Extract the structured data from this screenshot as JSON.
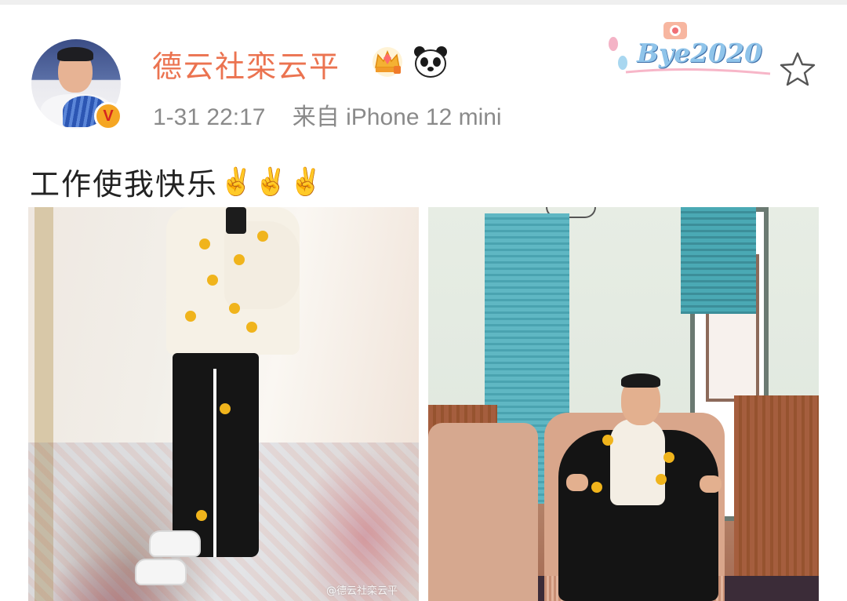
{
  "post": {
    "username": "德云社栾云平",
    "time": "1-31 22:17",
    "source": "来自 iPhone 12 mini",
    "text": "工作使我快乐",
    "emoji": "✌️✌️✌️",
    "card_text": "Bye2020",
    "watermark": "@德云社栾云平",
    "verified_label": "V"
  },
  "icons": {
    "avatar": "avatar-photo",
    "verified": "verified-badge",
    "crown": "crown-gem-icon",
    "panda": "panda-icon",
    "star": "star-outline-icon"
  },
  "colors": {
    "username": "#eb7350",
    "meta": "#8a8a8a",
    "badge": "#f5a623"
  }
}
